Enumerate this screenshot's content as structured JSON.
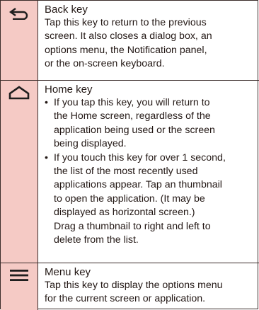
{
  "rows": [
    {
      "icon": "back-arrow-icon",
      "title": "Back key",
      "lines": [
        "Tap this key to return to the previous",
        "screen. It also closes a dialog box, an",
        "options menu, the Notification panel,",
        "or the on-screen keyboard."
      ]
    },
    {
      "icon": "home-icon",
      "title": "Home key",
      "bullet_marker": "•",
      "bullets": [
        {
          "lines": [
            "If you tap this key, you will return to",
            "the Home screen, regardless of the",
            "application being used or the screen",
            "being displayed."
          ]
        },
        {
          "lines": [
            "If you touch this key for over 1 second,",
            "the list of the most recently used",
            "applications appear. Tap an thumbnail",
            "to open the application. (It may be",
            "displayed as horizontal screen.)",
            "Drag a thumbnail to right and left to",
            "delete from the list."
          ]
        }
      ]
    },
    {
      "icon": "menu-icon",
      "title": "Menu key",
      "lines": [
        "Tap this key to display the options menu",
        "for the current screen or application."
      ]
    }
  ],
  "colors": {
    "icon_column": "#f5cac5",
    "rule": "#3a2c2a",
    "text": "#231815"
  }
}
